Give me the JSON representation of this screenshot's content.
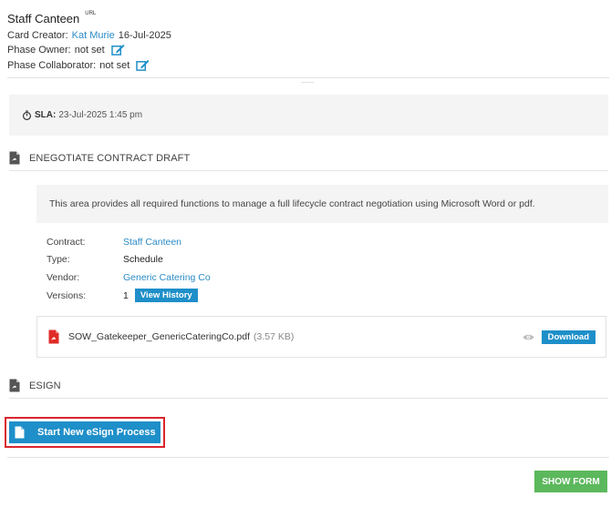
{
  "card": {
    "title": "Staff Canteen",
    "url_tag": "URL",
    "creator_label": "Card Creator:",
    "creator_name": "Kat Murie",
    "created_date": "16-Jul-2025",
    "phase_owner_label": "Phase Owner:",
    "phase_owner_value": "not set",
    "phase_collaborator_label": "Phase Collaborator:",
    "phase_collaborator_value": "not set"
  },
  "sla": {
    "label": "SLA:",
    "value": "23-Jul-2025 1:45 pm"
  },
  "negotiate": {
    "heading": "ENEGOTIATE CONTRACT DRAFT",
    "description": "This area provides all required functions to manage a full lifecycle contract negotiation using Microsoft Word or pdf.",
    "fields": {
      "contract_label": "Contract:",
      "contract_value": "Staff Canteen",
      "type_label": "Type:",
      "type_value": "Schedule",
      "vendor_label": "Vendor:",
      "vendor_value": "Generic Catering Co",
      "versions_label": "Versions:",
      "versions_value": "1",
      "view_history_label": "View History"
    },
    "file": {
      "name": "SOW_Gatekeeper_GenericCateringCo.pdf",
      "size": "(3.57 KB)",
      "download_label": "Download"
    }
  },
  "esign": {
    "heading": "ESIGN",
    "start_label": "Start New eSign Process"
  },
  "footer": {
    "show_form_label": "SHOW FORM"
  },
  "colors": {
    "link": "#2a8bc6",
    "primary_button": "#1e8fc9",
    "show_form_button": "#5cb85c",
    "highlight_border": "#d9262c"
  }
}
